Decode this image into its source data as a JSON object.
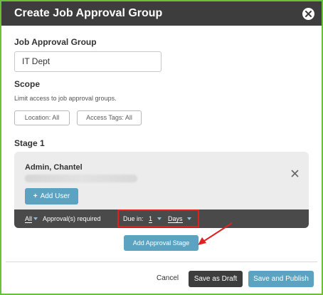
{
  "dialog": {
    "title": "Create Job Approval Group"
  },
  "group": {
    "label": "Job Approval Group",
    "value": "IT Dept"
  },
  "scope": {
    "label": "Scope",
    "hint": "Limit access to job approval groups.",
    "location_button": "Location: All",
    "tags_button": "Access Tags: All"
  },
  "stage": {
    "label": "Stage 1",
    "user_name": "Admin, Chantel",
    "add_user": "Add User",
    "approvals_value": "All",
    "approvals_text": "Approval(s) required",
    "due_label": "Due in:",
    "due_value": "1",
    "due_unit": "Days"
  },
  "actions": {
    "add_stage": "Add Approval Stage",
    "cancel": "Cancel",
    "save_draft": "Save as Draft",
    "save_publish": "Save and Publish"
  },
  "colors": {
    "header": "#3d3d3d",
    "accent": "#5ba3c0",
    "frame": "#6bbf3a",
    "highlight": "#e02020"
  }
}
